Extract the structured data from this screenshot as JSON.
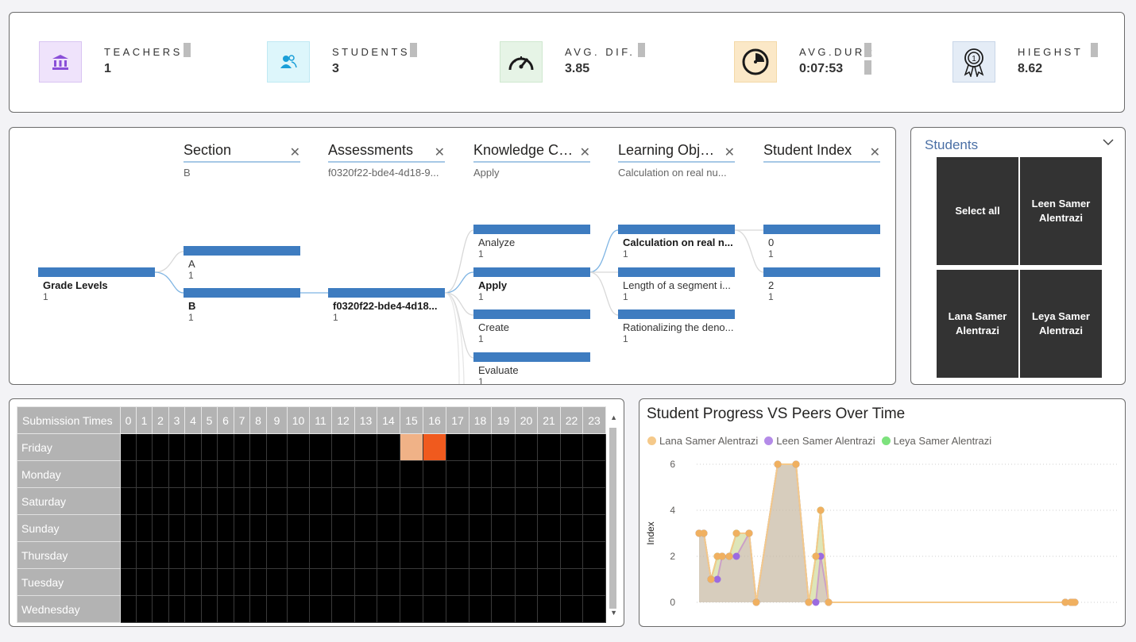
{
  "kpis": [
    {
      "label": "TEACHERS",
      "value": "1",
      "icon": "bank-icon",
      "color": "#8a4fd8",
      "bg": "#efe3fb"
    },
    {
      "label": "STUDENTS",
      "value": "3",
      "icon": "users-icon",
      "color": "#1a9fd8",
      "bg": "#ddf6fb"
    },
    {
      "label": "AVG. DIF.",
      "value": "3.85",
      "icon": "speedometer-icon",
      "color": "#1a1a1a",
      "bg": "#e6f4e6"
    },
    {
      "label": "AVG.DURR",
      "value": "0:07:53",
      "icon": "clock-icon",
      "color": "#1a1a1a",
      "bg": "#fbe8c7"
    },
    {
      "label": "HIEGHST",
      "value": "8.62",
      "icon": "award-icon",
      "color": "#1a1a1a",
      "bg": "#e4ecf6"
    }
  ],
  "tree": {
    "columns": [
      {
        "title": "Section",
        "sub": "B"
      },
      {
        "title": "Assessments",
        "sub": "f0320f22-bde4-4d18-9..."
      },
      {
        "title": "Knowledge Cats",
        "sub": "Apply"
      },
      {
        "title": "Learning Objec...",
        "sub": "Calculation on real nu..."
      },
      {
        "title": "Student Index",
        "sub": ""
      }
    ],
    "root": {
      "label": "Grade Levels",
      "count": "1"
    },
    "sections": [
      {
        "label": "A",
        "count": "1"
      },
      {
        "label": "B",
        "count": "1"
      }
    ],
    "assessments": [
      {
        "label": "f0320f22-bde4-4d18...",
        "count": "1"
      }
    ],
    "knowledge": [
      {
        "label": "Analyze",
        "count": "1"
      },
      {
        "label": "Apply",
        "count": "1"
      },
      {
        "label": "Create",
        "count": "1"
      },
      {
        "label": "Evaluate",
        "count": "1"
      }
    ],
    "objectives": [
      {
        "label": "Calculation on real n...",
        "count": "1"
      },
      {
        "label": "Length of a segment i...",
        "count": "1"
      },
      {
        "label": "Rationalizing the deno...",
        "count": "1"
      }
    ],
    "student_index": [
      {
        "label": "0",
        "count": "1"
      },
      {
        "label": "2",
        "count": "1"
      }
    ]
  },
  "slicer": {
    "title": "Students",
    "items": [
      "Select all",
      "Leen Samer Alentrazi",
      "Lana Samer Alentrazi",
      "Leya Samer Alentrazi"
    ]
  },
  "heatmap": {
    "header": "Submission Times",
    "hours": [
      "0",
      "1",
      "2",
      "3",
      "4",
      "5",
      "6",
      "7",
      "8",
      "9",
      "10",
      "11",
      "12",
      "13",
      "14",
      "15",
      "16",
      "17",
      "18",
      "19",
      "20",
      "21",
      "22",
      "23"
    ],
    "days": [
      "Friday",
      "Monday",
      "Saturday",
      "Sunday",
      "Thursday",
      "Tuesday",
      "Wednesday"
    ],
    "highlights": [
      {
        "day": "Friday",
        "hour": "15",
        "color": "#f0b287"
      },
      {
        "day": "Friday",
        "hour": "16",
        "color": "#f05a1e"
      }
    ]
  },
  "progress": {
    "title": "Student Progress VS Peers Over Time"
  },
  "chart_data": {
    "type": "area",
    "title": "Student Progress VS Peers Over Time",
    "xlabel": "",
    "ylabel": "Index",
    "ylim": [
      0,
      6
    ],
    "yticks": [
      "0",
      "2",
      "4",
      "6"
    ],
    "grid": true,
    "legend_position": "top-left",
    "x": [
      1,
      2,
      3,
      4,
      5,
      6,
      7,
      8,
      9,
      10,
      11,
      12,
      13,
      14,
      15,
      16,
      17,
      18,
      19
    ],
    "series": [
      {
        "name": "Lana Samer Alentrazi",
        "color": "#f5c98a",
        "values": [
          3,
          3,
          1,
          2,
          2,
          2,
          3,
          3,
          0,
          6,
          6,
          0,
          2,
          4,
          0,
          0,
          0,
          0,
          0
        ]
      },
      {
        "name": "Leen Samer Alentrazi",
        "color": "#b48be8",
        "values": [
          3,
          3,
          1,
          1,
          2,
          2,
          2,
          3,
          0,
          6,
          6,
          0,
          0,
          2,
          0,
          0,
          0,
          0,
          0
        ]
      },
      {
        "name": "Leya Samer Alentrazi",
        "color": "#7de27d",
        "values": [
          3,
          3,
          1,
          2,
          2,
          2,
          3,
          3,
          0,
          6,
          6,
          0,
          2,
          4,
          0,
          0,
          0,
          0,
          0
        ]
      }
    ]
  }
}
